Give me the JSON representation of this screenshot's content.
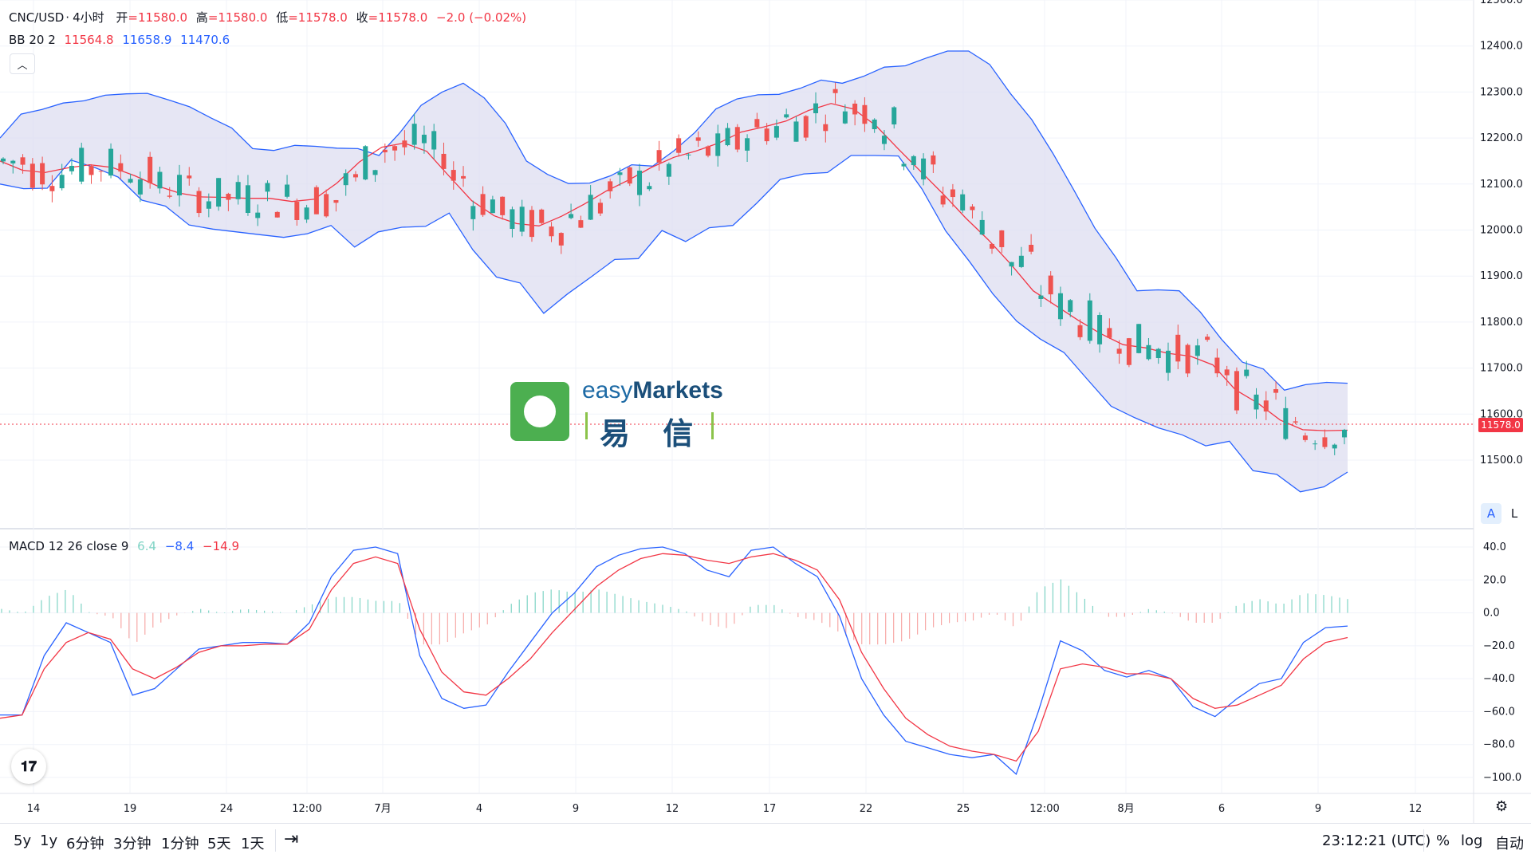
{
  "header": {
    "symbol": "CNC/USD",
    "interval": "4小时",
    "ohlc": [
      {
        "label": "开",
        "value": "11580.0"
      },
      {
        "label": "高",
        "value": "11580.0"
      },
      {
        "label": "低",
        "value": "11578.0"
      },
      {
        "label": "收",
        "value": "11578.0"
      }
    ],
    "change": "−2.0 (−0.02%)"
  },
  "bb_legend": {
    "name": "BB 20 2",
    "basis": "11564.8",
    "upper": "11658.9",
    "lower": "11470.6"
  },
  "macd_legend": {
    "name": "MACD 12 26 close 9",
    "hist": "6.4",
    "macd": "−8.4",
    "signal": "−14.9"
  },
  "last_price_label": "11578.0",
  "watermark": {
    "text": "easy",
    "text_bold": "Markets",
    "cn": "易 信"
  },
  "buttons": {
    "auto_scale": "A",
    "log_scale": "L"
  },
  "bottom": {
    "ranges": [
      "5y",
      "1y",
      "6分钟",
      "3分钟",
      "1分钟",
      "5天",
      "1天"
    ],
    "time": "23:12:21 (UTC)",
    "percent": "%",
    "log": "log",
    "auto": "自动"
  },
  "colors": {
    "up": "#26a69a",
    "down": "#ef5350",
    "bb_line": "#2962ff",
    "bb_basis": "#f23645",
    "bb_fill": "#dcdcf0",
    "macd": "#2962ff",
    "signal": "#f23645"
  },
  "chart_data": [
    {
      "type": "candlestick",
      "title": "CNC/USD · 4小时",
      "x_ticks": [
        "14",
        "19",
        "24",
        "12:00",
        "7月",
        "4",
        "9",
        "12",
        "17",
        "22",
        "25",
        "12:00",
        "8月",
        "6",
        "9",
        "12"
      ],
      "y_ticks": [
        12500,
        12400,
        12300,
        12200,
        12100,
        12000,
        11900,
        11800,
        11700,
        11600,
        11500
      ],
      "ylim": [
        11400,
        12500
      ],
      "last_price": 11578.0,
      "series": [
        {
          "name": "BB upper",
          "values": [
            12200,
            12252,
            12262,
            12276,
            12281,
            12293,
            12296,
            12297,
            12283,
            12268,
            12244,
            12222,
            12177,
            12173,
            12184,
            12182,
            12178,
            12177,
            12162,
            12212,
            12271,
            12300,
            12319,
            12287,
            12232,
            12150,
            12121,
            12101,
            12102,
            12118,
            12142,
            12139,
            12172,
            12212,
            12263,
            12285,
            12294,
            12295,
            12308,
            12326,
            12319,
            12334,
            12354,
            12357,
            12374,
            12389,
            12389,
            12360,
            12296,
            12240,
            12167,
            12087,
            12004,
            11940,
            11868,
            11870,
            11868,
            11822,
            11763,
            11713,
            11698,
            11652,
            11664,
            11669,
            11667
          ]
        },
        {
          "name": "BB basis",
          "values": [
            12150,
            12130,
            12125,
            12135,
            12142,
            12136,
            12118,
            12096,
            12080,
            12072,
            12071,
            12069,
            12069,
            12062,
            12067,
            12102,
            12148,
            12180,
            12189,
            12171,
            12117,
            12064,
            12031,
            12014,
            12009,
            12030,
            12056,
            12085,
            12109,
            12136,
            12158,
            12172,
            12189,
            12213,
            12224,
            12237,
            12260,
            12275,
            12263,
            12227,
            12176,
            12127,
            12078,
            12026,
            11979,
            11926,
            11868,
            11836,
            11804,
            11775,
            11751,
            11744,
            11732,
            11726,
            11707,
            11653,
            11624,
            11587,
            11566,
            11564,
            11565
          ]
        },
        {
          "name": "BB lower",
          "values": [
            12100,
            12090,
            12091,
            12152,
            12136,
            12115,
            12065,
            12052,
            12011,
            12002,
            11996,
            11990,
            11984,
            11992,
            12010,
            11963,
            11996,
            12006,
            12008,
            12037,
            11957,
            11898,
            11885,
            11819,
            11861,
            11898,
            11936,
            11938,
            11999,
            11975,
            12005,
            12010,
            12058,
            12110,
            12122,
            12125,
            12162,
            12162,
            12161,
            12089,
            11998,
            11932,
            11861,
            11802,
            11763,
            11734,
            11675,
            11617,
            11592,
            11570,
            11555,
            11531,
            11541,
            11477,
            11469,
            11431,
            11442,
            11474
          ]
        },
        {
          "name": "MACD",
          "values": [
            -62,
            -62,
            -26,
            -6,
            -12,
            -18,
            -50,
            -46,
            -34,
            -22,
            -20,
            -18,
            -18,
            -19,
            -6,
            22,
            38,
            40,
            36,
            -26,
            -52,
            -58,
            -56,
            -36,
            -18,
            0,
            12,
            28,
            35,
            39,
            40,
            36,
            26,
            22,
            38,
            40,
            30,
            22,
            -2,
            -40,
            -62,
            -78,
            -82,
            -86,
            -88,
            -86,
            -98,
            -60,
            -17,
            -23,
            -35,
            -39,
            -35,
            -40,
            -57,
            -63,
            -52,
            -43,
            -40,
            -18,
            -9,
            -8
          ]
        },
        {
          "name": "Signal",
          "values": [
            -64,
            -62,
            -34,
            -18,
            -12,
            -16,
            -34,
            -40,
            -33,
            -24,
            -20,
            -20,
            -19,
            -19,
            -10,
            14,
            30,
            34,
            30,
            -10,
            -36,
            -48,
            -50,
            -40,
            -28,
            -12,
            2,
            16,
            26,
            33,
            36,
            35,
            32,
            30,
            34,
            36,
            32,
            26,
            8,
            -24,
            -46,
            -64,
            -74,
            -81,
            -84,
            -86,
            -90,
            -72,
            -34,
            -31,
            -33,
            -37,
            -37,
            -40,
            -52,
            -58,
            -56,
            -50,
            -44,
            -28,
            -18,
            -15
          ]
        }
      ]
    }
  ]
}
